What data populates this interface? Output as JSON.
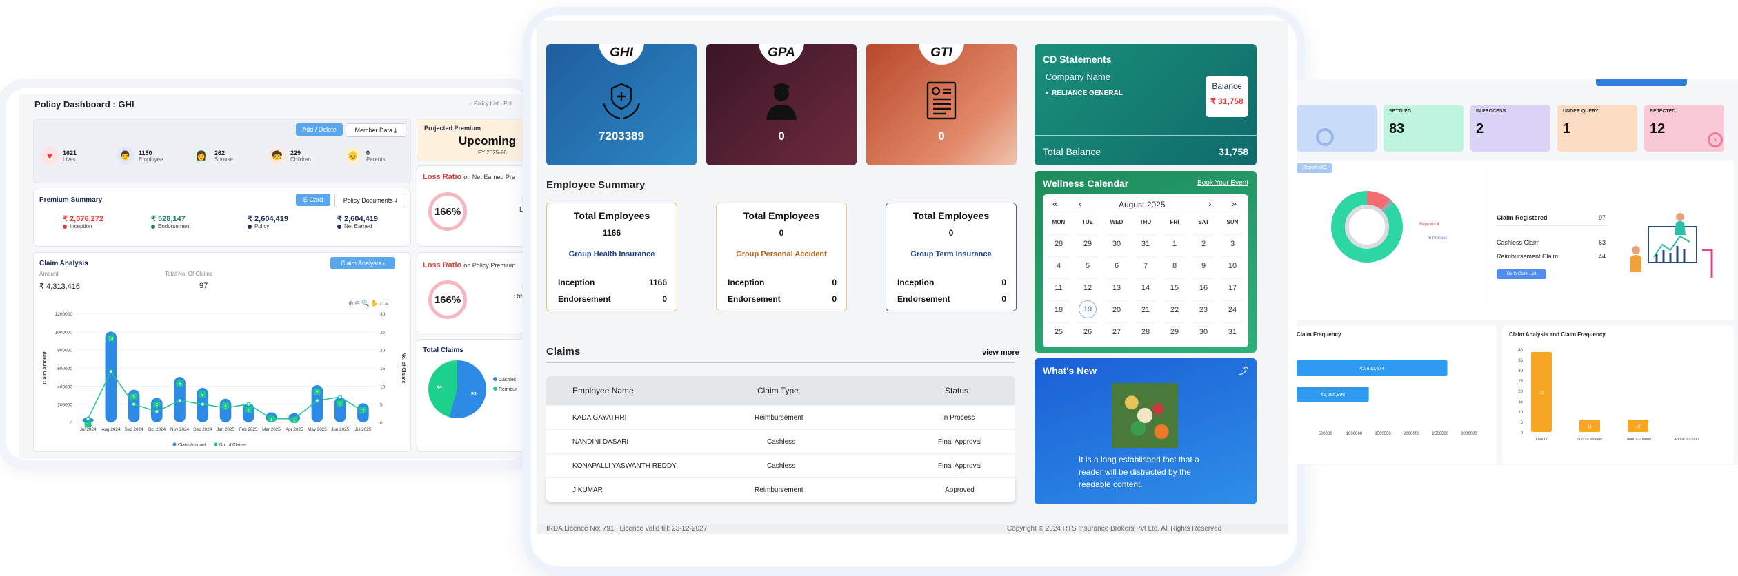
{
  "left": {
    "title": "Policy Dashboard : GHI",
    "breadcrumb": "⌂ Policy List  ›  Poli",
    "buttons": {
      "add_delete": "Add / Delete",
      "member_data": "Member Data ⤓",
      "ecard": "E-Card",
      "policy_docs": "Policy Documents ⤓",
      "claim_analysis": "Claim Analysis ›"
    },
    "stats": [
      {
        "value": "1621",
        "label": "Lives",
        "icon": "heart-icon"
      },
      {
        "value": "1130",
        "label": "Employee",
        "icon": "employee-avatar-icon"
      },
      {
        "value": "262",
        "label": "Spouse",
        "icon": "spouse-avatar-icon"
      },
      {
        "value": "229",
        "label": "Children",
        "icon": "child-avatar-icon"
      },
      {
        "value": "0",
        "label": "Parents",
        "icon": "parents-avatar-icon"
      }
    ],
    "premium": {
      "title": "Premium Summary",
      "items": [
        {
          "value": "₹ 2,076,272",
          "label": "Inception",
          "color": "#e53935"
        },
        {
          "value": "₹ 528,147",
          "label": "Endorsement",
          "color": "#1e7b6e"
        },
        {
          "value": "₹ 2,604,419",
          "label": "Policy",
          "color": "#1a2a55"
        },
        {
          "value": "₹ 2,604,419",
          "label": "Net Earned",
          "color": "#1a2a55"
        }
      ]
    },
    "claim": {
      "title": "Claim Analysis",
      "amount_label": "Amount",
      "count_label": "Total No. Of Claims",
      "amount": "₹ 4,313,416",
      "count": "97"
    },
    "projected": {
      "label": "Projected Premium",
      "status": "Upcoming",
      "fy": "FY 2025-26"
    },
    "loss_ratio_1": {
      "prefix": "Loss Ratio",
      "suffix": "on Net Earned Pre",
      "value": "166%",
      "side1": "Da",
      "side2": "Lap",
      "side3": "C"
    },
    "loss_ratio_2": {
      "prefix": "Loss Ratio",
      "suffix": "on Policy Premium",
      "value": "166%",
      "side1": "Da",
      "side2": "Remc",
      "side3": "C"
    },
    "total_claims": {
      "title": "Total Claims",
      "slice_a": "44",
      "slice_b": "53",
      "legend_a": "Cashles",
      "legend_b": "Reimbur"
    }
  },
  "chart_data": {
    "type": "bar",
    "categories": [
      "Jul 2024",
      "Aug 2024",
      "Sep 2024",
      "Oct 2024",
      "Nov 2024",
      "Dec 2024",
      "Jan 2025",
      "Feb 2025",
      "Mar 2025",
      "Apr 2025",
      "May 2025",
      "Jun 2025",
      "Jul 2025"
    ],
    "series": [
      {
        "name": "Claim Amount",
        "values": [
          50000,
          1000000,
          360000,
          270000,
          500000,
          380000,
          260000,
          210000,
          110000,
          100000,
          410000,
          280000,
          210000
        ],
        "color": "#2d8be6"
      },
      {
        "name": "No. of Claims",
        "values": [
          1,
          14,
          5,
          3,
          6,
          5,
          4,
          5,
          1,
          1,
          6,
          7,
          3
        ],
        "color": "#1cc88a"
      }
    ],
    "labels": [
      "1",
      "14",
      "5",
      "3",
      "6",
      "5",
      "4",
      "5",
      "1",
      "1",
      "6",
      "7",
      "3"
    ],
    "ylabel": "Claim Amount",
    "y2label": "No. of Claims",
    "ylim": [
      0,
      1200000
    ],
    "y2lim": [
      0,
      30
    ],
    "yticks": [
      "1200000",
      "1000000",
      "800000",
      "600000",
      "400000",
      "200000",
      "0"
    ],
    "y2ticks": [
      "30",
      "25",
      "20",
      "15",
      "10",
      "5",
      "0"
    ],
    "legend_position": "bottom"
  },
  "mid": {
    "tiles": [
      {
        "tab": "GHI",
        "value": "7203389",
        "icon": "shield-hands-icon"
      },
      {
        "tab": "GPA",
        "value": "0",
        "icon": "doctor-icon"
      },
      {
        "tab": "GTI",
        "value": "0",
        "icon": "document-icon"
      }
    ],
    "cd": {
      "title": "CD Statements",
      "company_label": "Company Name",
      "company": "RELIANCE GENERAL",
      "balance_label": "Balance",
      "balance": "₹ 31,758",
      "total_label": "Total Balance",
      "total": "31,758"
    },
    "employee_summary": {
      "title": "Employee Summary",
      "cards": [
        {
          "heading": "Total Employees",
          "count": "1166",
          "group": "Group Health Insurance",
          "inception_label": "Inception",
          "inception": "1166",
          "endorsement_label": "Endorsement",
          "endorsement": "0",
          "border": "#e8c27a",
          "group_color": "#1a3f8a"
        },
        {
          "heading": "Total Employees",
          "count": "0",
          "group": "Group Personal Accident",
          "inception_label": "Inception",
          "inception": "0",
          "endorsement_label": "Endorsement",
          "endorsement": "0",
          "border": "#f0c68a",
          "group_color": "#b2611a"
        },
        {
          "heading": "Total Employees",
          "count": "0",
          "group": "Group Term Insurance",
          "inception_label": "Inception",
          "inception": "0",
          "endorsement_label": "Endorsement",
          "endorsement": "0",
          "border": "#4f5e80",
          "group_color": "#1a3f8a"
        }
      ]
    },
    "claims": {
      "title": "Claims",
      "view_more": "view more",
      "headers": [
        "Employee Name",
        "Claim Type",
        "Status"
      ],
      "rows": [
        [
          "KADA GAYATHRI",
          "Reimbursement",
          "In Process"
        ],
        [
          "NANDINI DASARI",
          "Cashless",
          "Final Approval"
        ],
        [
          "KONAPALLI YASWANTH REDDY",
          "Cashless",
          "Final Approval"
        ],
        [
          "J KUMAR",
          "Reimbursement",
          "Approved"
        ]
      ]
    },
    "calendar": {
      "title": "Wellness Calendar",
      "book": "Book Your Event",
      "month": "August 2025",
      "nav": {
        "first": "«",
        "prev": "‹",
        "next": "›",
        "last": "»"
      },
      "days": [
        "MON",
        "TUE",
        "WED",
        "THU",
        "FRI",
        "SAT",
        "SUN"
      ],
      "weeks": [
        [
          "28",
          "29",
          "30",
          "31",
          "1",
          "2",
          "3"
        ],
        [
          "4",
          "5",
          "6",
          "7",
          "8",
          "9",
          "10"
        ],
        [
          "11",
          "12",
          "13",
          "14",
          "15",
          "16",
          "17"
        ],
        [
          "18",
          "19",
          "20",
          "21",
          "22",
          "23",
          "24"
        ],
        [
          "25",
          "26",
          "27",
          "28",
          "29",
          "30",
          "31"
        ]
      ],
      "selected": "19"
    },
    "whats_new": {
      "title": "What's New",
      "text": "It is a long established fact that a reader will be distracted by the readable content."
    },
    "footer_left": "IRDA Licence No: 791 | Licence valid till: 23-12-2027",
    "footer_right": "Copyright © 2024 RTS Insurance Brokers Pvt Ltd. All Rights Reserved"
  },
  "right": {
    "cards": [
      {
        "title": "",
        "value": "",
        "color": "#c9dcfa"
      },
      {
        "title": "SETTLED",
        "value": "83",
        "color": "#bff5de"
      },
      {
        "title": "IN PROCESS",
        "value": "2",
        "color": "#dcd4f6"
      },
      {
        "title": "UNDER QUERY",
        "value": "1",
        "color": "#fcdcc2"
      },
      {
        "title": "REJECTED",
        "value": "12",
        "color": "#fbc9d6"
      }
    ],
    "report_btn": "Report MIS",
    "donut_rejected": "Rejected 4",
    "donut_inprocess": "In Process",
    "claim_registered_label": "Claim Registered",
    "claim_registered": "97",
    "cashless_label": "Cashless Claim",
    "cashless": "53",
    "reimb_label": "Reimbursement Claim",
    "reimb": "44",
    "goto_btn": "Go to Claim List",
    "freq_title": "Claim Frequency",
    "freq_bars": [
      "₹2,622,674",
      "₹1,255,996"
    ],
    "freq_ticks": [
      "500000",
      "1000000",
      "1500000",
      "2000000",
      "2500000",
      "3000000"
    ],
    "cf_title": "Claim Analysis and Claim Frequency",
    "cf_yticks": [
      "40",
      "35",
      "30",
      "25",
      "20",
      "15",
      "10",
      "5",
      "0"
    ],
    "cf_values": [
      72,
      11,
      12
    ],
    "cf_labels": [
      "72",
      "11",
      "12"
    ],
    "cf_cats": [
      "0-50000",
      "50001-100000",
      "100001-200000",
      "Above 200000"
    ]
  }
}
